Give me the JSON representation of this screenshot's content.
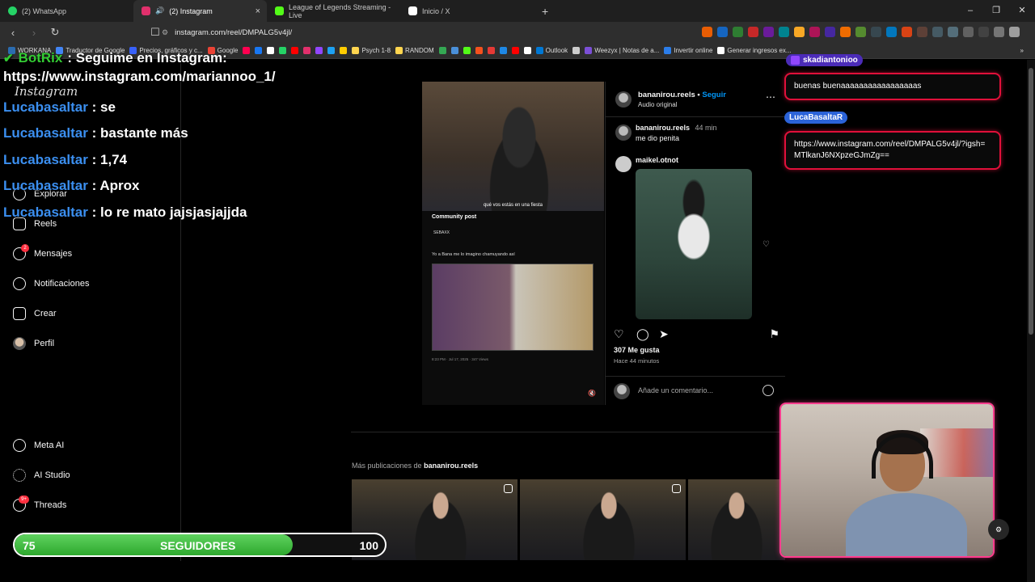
{
  "browser": {
    "tabs": [
      {
        "label": "(2) WhatsApp",
        "color": "#25d366"
      },
      {
        "label": "(2) Instagram",
        "color": "#e1306c",
        "active": true
      },
      {
        "label": "League of Legends  Streaming - Live",
        "color": "#53fc18"
      },
      {
        "label": "Inicio / X",
        "color": "#ffffff"
      }
    ],
    "close_symbol": "×",
    "new_tab_symbol": "+",
    "window_controls": [
      "–",
      "❐",
      "✕"
    ],
    "url": "instagram.com/reel/DMPALG5v4jl/",
    "bookmarks": [
      {
        "label": "WORKANA",
        "color": "#2b6cb0"
      },
      {
        "label": "Traductor de Google",
        "color": "#4285f4"
      },
      {
        "label": "Precios, gráficos y c...",
        "color": "#3861fb"
      },
      {
        "label": "Google",
        "color": "#ea4335"
      },
      {
        "label": "",
        "color": "#ff0050"
      },
      {
        "label": "",
        "color": "#1877f2"
      },
      {
        "label": "",
        "color": "#ffffff"
      },
      {
        "label": "",
        "color": "#25d366"
      },
      {
        "label": "",
        "color": "#ff0000"
      },
      {
        "label": "",
        "color": "#e1306c"
      },
      {
        "label": "",
        "color": "#9146ff"
      },
      {
        "label": "",
        "color": "#1da1f2"
      },
      {
        "label": "",
        "color": "#ffcc00"
      },
      {
        "label": "Psych 1-8",
        "color": "#ffd54f"
      },
      {
        "label": "RANDOM",
        "color": "#ffd54f"
      },
      {
        "label": "",
        "color": "#34a853"
      },
      {
        "label": "",
        "color": "#4a90d9"
      },
      {
        "label": "",
        "color": "#53fc18"
      },
      {
        "label": "",
        "color": "#f4511e"
      },
      {
        "label": "",
        "color": "#e53935"
      },
      {
        "label": "",
        "color": "#1e88e5"
      },
      {
        "label": "",
        "color": "#ff0000"
      },
      {
        "label": "",
        "color": "#ffffff"
      },
      {
        "label": "Outlook",
        "color": "#0078d4"
      },
      {
        "label": "",
        "color": "#cccccc"
      },
      {
        "label": "Weezyx | Notas de a...",
        "color": "#7b4fd6"
      },
      {
        "label": "Invertir online",
        "color": "#2b7de9"
      },
      {
        "label": "Generar ingresos ex...",
        "color": "#ffffff"
      }
    ],
    "more_bookmarks": "»"
  },
  "instagram": {
    "logo": "Instagram",
    "sidebar": [
      {
        "label": "Explorar",
        "icon": "compass-icon"
      },
      {
        "label": "Reels",
        "icon": "reels-icon"
      },
      {
        "label": "Mensajes",
        "icon": "messenger-icon",
        "badge": "2"
      },
      {
        "label": "Notificaciones",
        "icon": "heart-icon"
      },
      {
        "label": "Crear",
        "icon": "plus-icon"
      },
      {
        "label": "Perfil",
        "icon": "avatar-icon"
      },
      {
        "label": "Meta AI",
        "icon": "meta-ai-icon"
      },
      {
        "label": "AI Studio",
        "icon": "ai-studio-icon"
      },
      {
        "label": "Threads",
        "icon": "threads-icon",
        "badge": "9+"
      }
    ],
    "post": {
      "username": "bananirou.reels",
      "separator": "•",
      "follow": "Seguir",
      "audio": "Audio original",
      "more": "⋯",
      "comments": [
        {
          "user": "bananirou.reels",
          "time": "44 min",
          "text": "me dio penita"
        },
        {
          "user": "maikel.otnot",
          "time": "",
          "text": ""
        }
      ],
      "likes": "307 Me gusta",
      "ago": "Hace 44 minutos",
      "comment_placeholder": "Añade un comentario...",
      "media": {
        "caption": "qué vos estás en una fiesta",
        "community_title": "Community post",
        "tweet_user": "SEBAXX",
        "tweet_text": "Yo a Bana me lo imagino chamuyando así",
        "tweet_stats": "8:23 PM · Jul 17, 2025 · 347 Views",
        "mute_symbol": "🔇"
      }
    },
    "more_posts": {
      "prefix": "Más publicaciones de",
      "user": "bananirou.reels"
    }
  },
  "stream_chat": {
    "bot": {
      "name": "BotRix",
      "text": ": Seguime en Instagram:",
      "check": "✔"
    },
    "link": "https://www.instagram.com/mariannoo_1/",
    "messages": [
      {
        "user": "Lucabasaltar",
        "text": " : se"
      },
      {
        "user": "Lucabasaltar",
        "text": " : bastante más"
      },
      {
        "user": "Lucabasaltar",
        "text": " : 1,74"
      },
      {
        "user": "Lucabasaltar",
        "text": " : Aprox"
      },
      {
        "user": "Lucabasaltar",
        "text": " : lo re mato jajsjasjajjda"
      }
    ]
  },
  "right_chat": [
    {
      "user": "skadiantonioo",
      "text": "buenas buenaaaaaaaaaaaaaaaaas"
    },
    {
      "user": "LucaBasaltaR",
      "text": "https://www.instagram.com/reel/DMPALG5v4jl/?igsh=MTlkanJ6NXpzeGJmZg=="
    }
  ],
  "followers_goal": {
    "current": "75",
    "label": "SEGUIDORES",
    "goal": "100",
    "progress": 0.75
  },
  "colors": {
    "accent_blue": "#0095f6",
    "chat_user": "#3b8ff0",
    "bot_green": "#33cc33",
    "bubble_border": "#e0103a"
  }
}
